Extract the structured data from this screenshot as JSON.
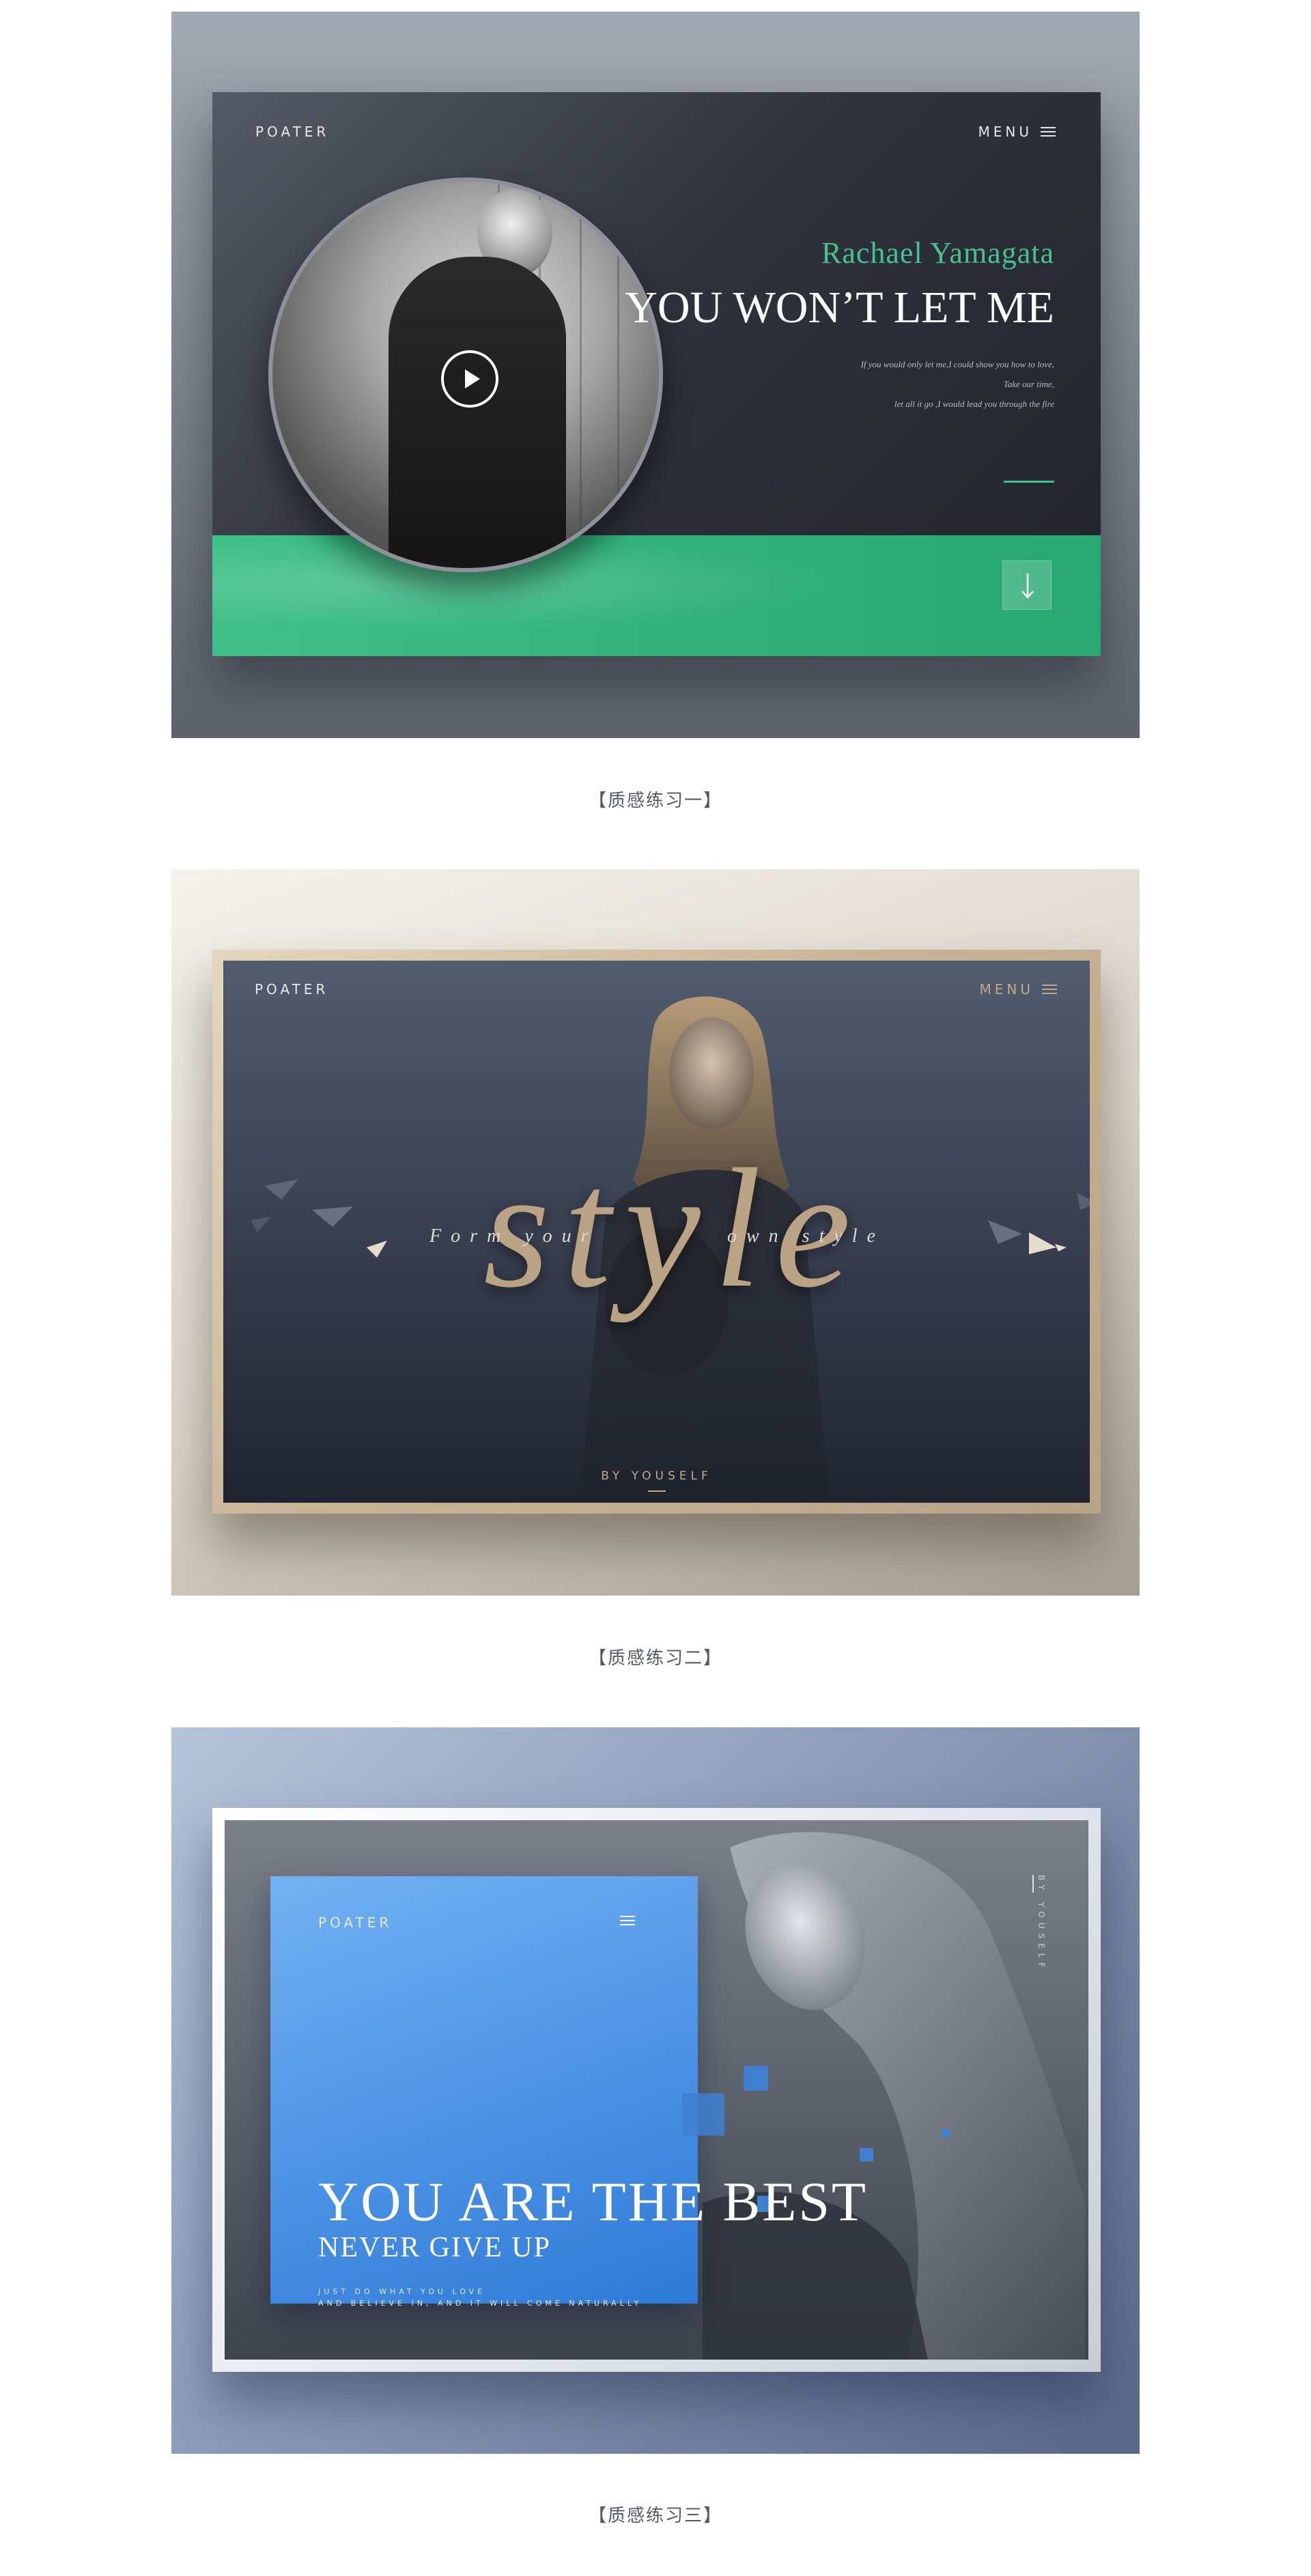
{
  "panels": [
    {
      "logo": "POATER",
      "menu_label": "MENU",
      "artist": "Rachael Yamagata",
      "song_title": "YOU WON’T LET ME",
      "lyrics": [
        "If you would only let me,I could show you how to love,",
        "Take our time,",
        "let all it go ,I would lead you through the fire"
      ],
      "caption": "【质感练习一】"
    },
    {
      "logo": "POATER",
      "menu_label": "MENU",
      "big_word": "style",
      "tagline_left": "Form your",
      "tagline_right": "own style",
      "footer": "BY YOUSELF",
      "caption": "【质感练习二】"
    },
    {
      "logo": "POATER",
      "headline": "YOU ARE THE BEST",
      "subheadline": "NEVER GIVE UP",
      "body_lines": [
        "JUST DO WHAT YOU LOVE",
        "AND BELIEVE IN, AND IT WILL COME NATURALLY"
      ],
      "vertical_text": "BY YOUSELF",
      "caption": "【质感练习三】"
    }
  ],
  "colors": {
    "accent_green": "#3fc08a",
    "accent_gold": "#b9a384",
    "accent_blue": "#4e95e6"
  },
  "icons": [
    "play-icon",
    "menu-icon",
    "arrow-down-icon"
  ]
}
